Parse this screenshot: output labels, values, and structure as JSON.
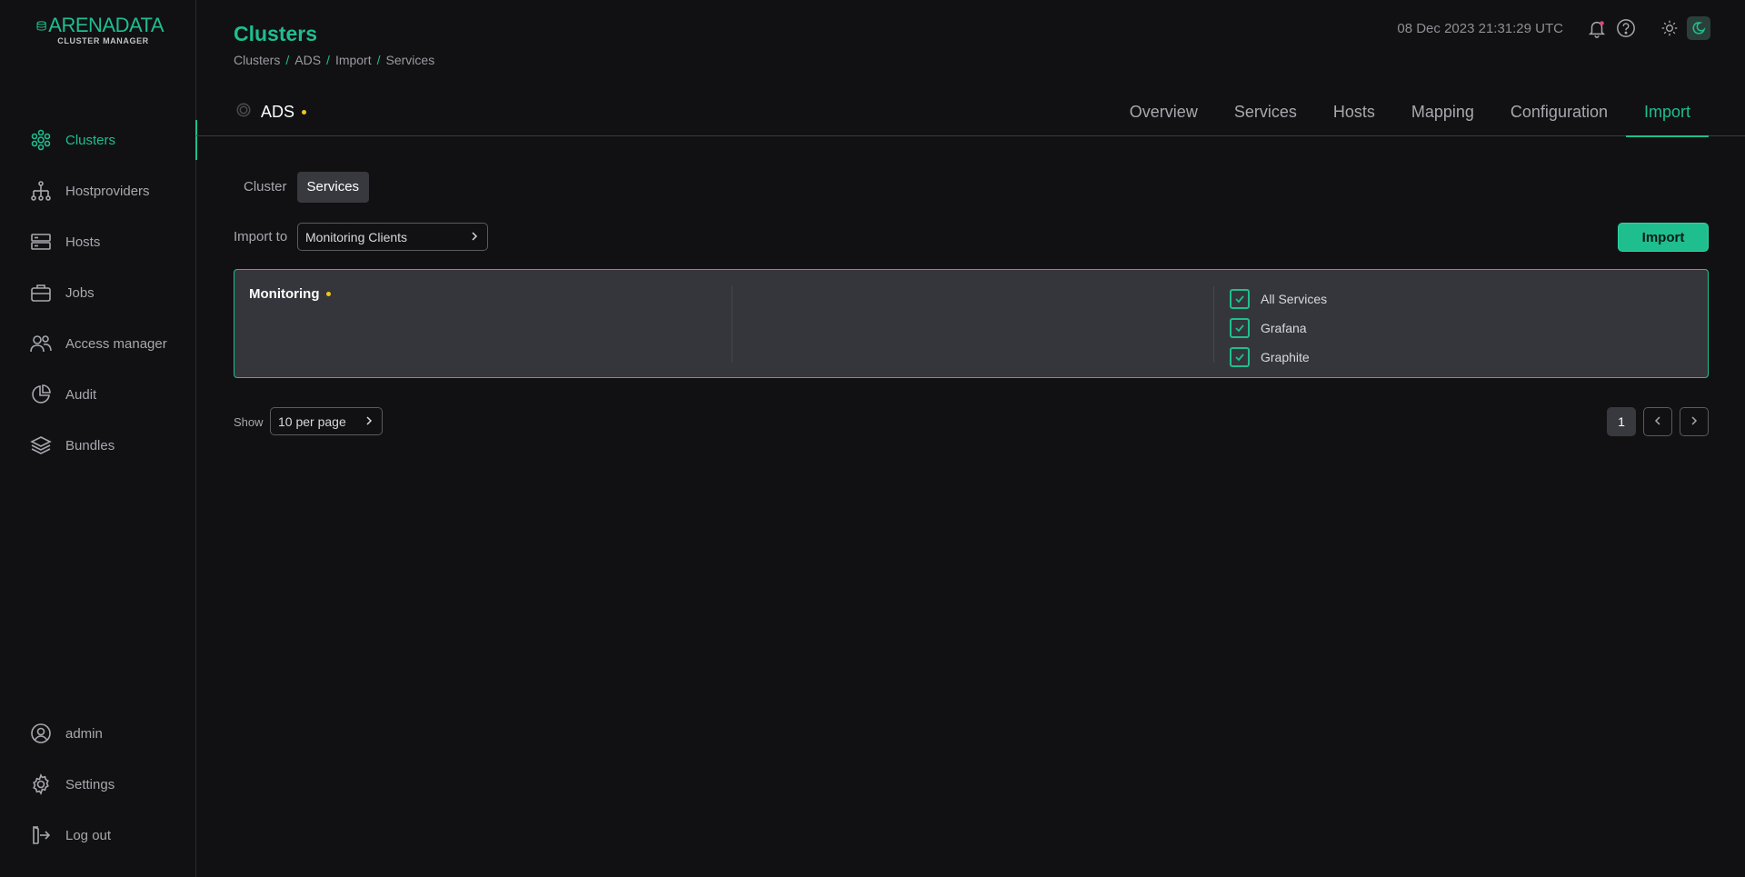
{
  "app": {
    "logo_title": "ARENADATA",
    "logo_subtitle": "CLUSTER MANAGER"
  },
  "sidebar": {
    "items": [
      {
        "label": "Clusters",
        "icon": "clusters-icon",
        "active": true
      },
      {
        "label": "Hostproviders",
        "icon": "hostproviders-icon"
      },
      {
        "label": "Hosts",
        "icon": "hosts-icon"
      },
      {
        "label": "Jobs",
        "icon": "jobs-icon"
      },
      {
        "label": "Access manager",
        "icon": "access-manager-icon"
      },
      {
        "label": "Audit",
        "icon": "audit-icon"
      },
      {
        "label": "Bundles",
        "icon": "bundles-icon"
      }
    ],
    "bottom": [
      {
        "label": "admin",
        "icon": "user-icon"
      },
      {
        "label": "Settings",
        "icon": "settings-icon"
      },
      {
        "label": "Log out",
        "icon": "logout-icon"
      }
    ]
  },
  "header": {
    "title": "Clusters",
    "breadcrumb": [
      "Clusters",
      "ADS",
      "Import",
      "Services"
    ],
    "separator": "/",
    "datetime": "08 Dec 2023  21:31:29  UTC"
  },
  "entity": {
    "name": "ADS"
  },
  "tabs": [
    "Overview",
    "Services",
    "Hosts",
    "Mapping",
    "Configuration",
    "Import"
  ],
  "active_tab": "Import",
  "subtabs": [
    "Cluster",
    "Services"
  ],
  "active_subtab": "Services",
  "import": {
    "label": "Import to",
    "selected": "Monitoring Clients",
    "button": "Import"
  },
  "card": {
    "title": "Monitoring",
    "options": [
      {
        "label": "All Services",
        "checked": true
      },
      {
        "label": "Grafana",
        "checked": true
      },
      {
        "label": "Graphite",
        "checked": true
      }
    ]
  },
  "pagination": {
    "show_label": "Show",
    "per_page": "10 per page",
    "current_page": "1"
  },
  "colors": {
    "accent": "#1fbe8e",
    "background": "#111114",
    "card": "#35363b",
    "warning_dot": "#f5c518"
  }
}
